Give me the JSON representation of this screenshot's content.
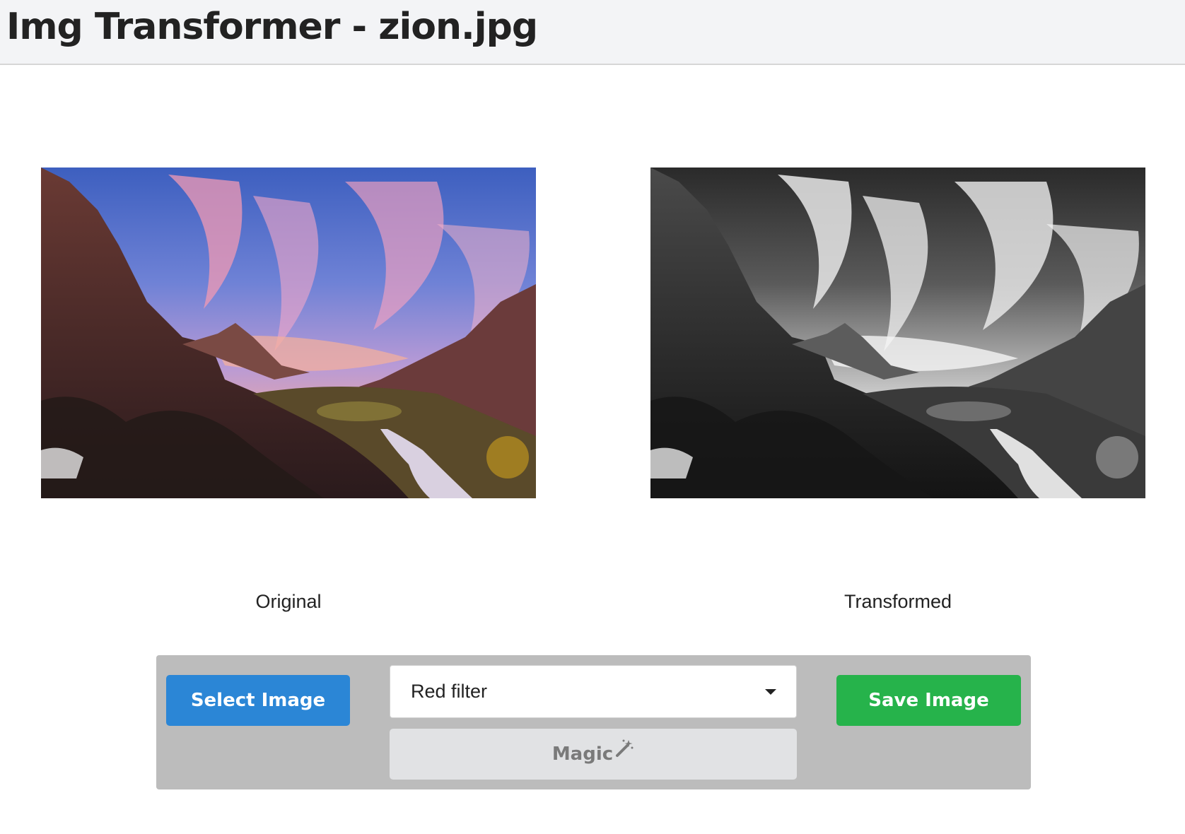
{
  "header": {
    "title": "Img Transformer - zion.jpg"
  },
  "panels": {
    "original": {
      "caption": "Original",
      "image": "landscape-photo-color"
    },
    "transformed": {
      "caption": "Transformed",
      "image": "landscape-photo-grayscale"
    }
  },
  "toolbar": {
    "select_label": "Select Image",
    "filter_value": "Red filter",
    "magic_label": "Magic",
    "save_label": "Save Image"
  },
  "colors": {
    "select_button": "#2b86d6",
    "save_button": "#26b34b",
    "toolbar_bg": "#bcbcbc",
    "magic_button_bg": "#e1e2e4"
  },
  "icons": {
    "dropdown": "caret-down-icon",
    "magic": "magic-wand-icon"
  }
}
